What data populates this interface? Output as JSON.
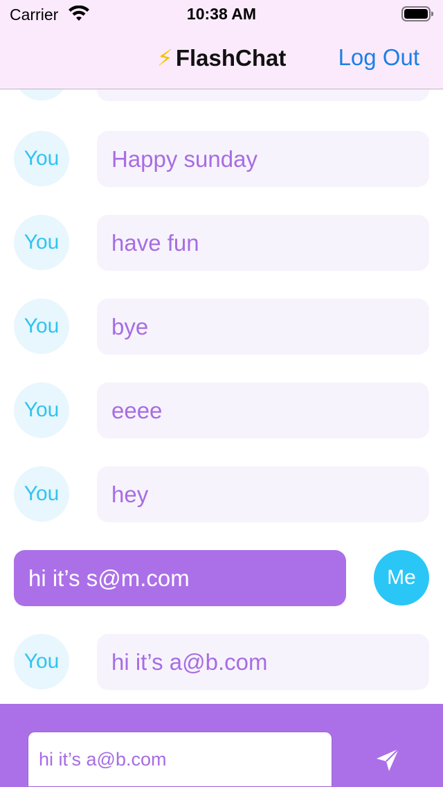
{
  "status_bar": {
    "carrier": "Carrier",
    "time": "10:38 AM",
    "icons": [
      "wifi-icon",
      "battery-icon"
    ]
  },
  "nav": {
    "title_icon": "⚡",
    "title": "FlashChat",
    "logout_label": "Log Out"
  },
  "messages": [
    {
      "sender": "You",
      "text": "Happy sunday"
    },
    {
      "sender": "You",
      "text": "have fun"
    },
    {
      "sender": "You",
      "text": "bye"
    },
    {
      "sender": "You",
      "text": "eeee"
    },
    {
      "sender": "You",
      "text": "hey"
    },
    {
      "sender": "Me",
      "text": "hi it’s s@m.com"
    },
    {
      "sender": "You",
      "text": "hi it’s a@b.com"
    }
  ],
  "composer": {
    "value": "hi it’s a@b.com",
    "send_icon": "paper-plane-icon"
  },
  "colors": {
    "header_bg": "#fbeafc",
    "accent_purple": "#ab70e8",
    "link_blue": "#1a7fe6",
    "me_avatar": "#2ac6f6",
    "you_avatar_bg": "#e8f6fd",
    "you_bubble_bg": "#f7f3fc"
  }
}
